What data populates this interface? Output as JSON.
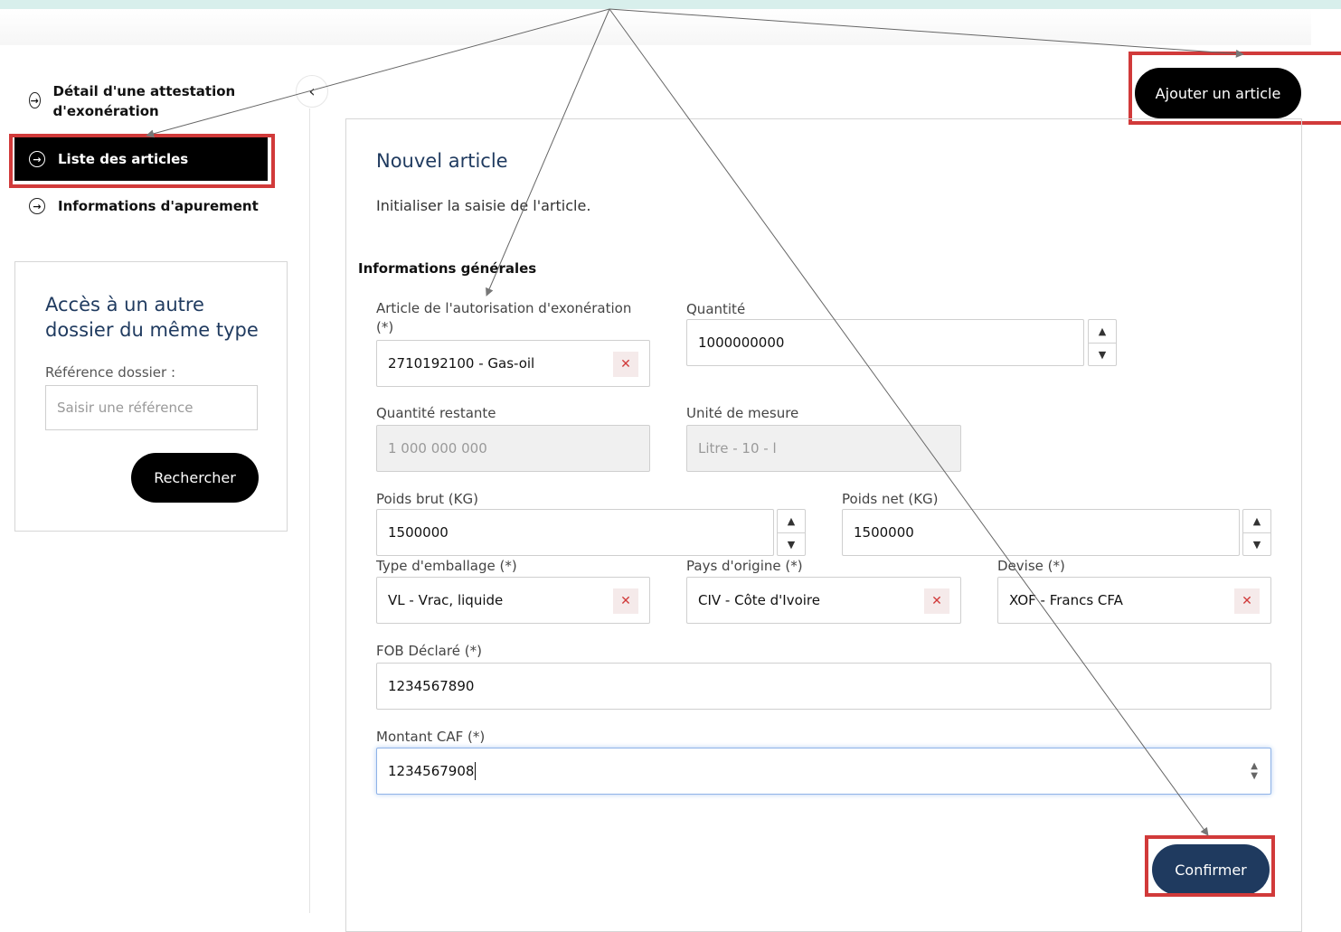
{
  "sidebar": {
    "items": [
      {
        "label": "Détail d'une attestation d'exonération",
        "active": false
      },
      {
        "label": "Liste des articles",
        "active": true
      },
      {
        "label": "Informations d'apurement",
        "active": false
      }
    ],
    "search_card": {
      "title": "Accès à un autre dossier du même type",
      "ref_label": "Référence dossier :",
      "ref_placeholder": "Saisir une référence",
      "search_button": "Rechercher"
    }
  },
  "header": {
    "add_button": "Ajouter un article"
  },
  "form": {
    "title": "Nouvel article",
    "subtitle": "Initialiser la saisie de l'article.",
    "section": "Informations générales",
    "article_label": "Article de l'autorisation d'exonération (*)",
    "article_value": "2710192100 - Gas-oil",
    "quantite_label": "Quantité",
    "quantite_value": "1000000000",
    "quantite_restante_label": "Quantité restante",
    "quantite_restante_value": "1 000 000 000",
    "unite_label": "Unité de mesure",
    "unite_value": "Litre - 10 - l",
    "poids_brut_label": "Poids brut (KG)",
    "poids_brut_value": "1500000",
    "poids_net_label": "Poids net (KG)",
    "poids_net_value": "1500000",
    "emballage_label": "Type d'emballage (*)",
    "emballage_value": "VL - Vrac, liquide",
    "pays_label": "Pays d'origine (*)",
    "pays_value": "CIV - Côte d'Ivoire",
    "devise_label": "Devise (*)",
    "devise_value": "XOF - Francs CFA",
    "fob_label": "FOB Déclaré (*)",
    "fob_value": "1234567890",
    "caf_label": "Montant CAF (*)",
    "caf_value": "1234567908",
    "confirm_button": "Confirmer"
  },
  "colors": {
    "accent_navy": "#1f3a5f",
    "highlight_red": "#d13a3a",
    "clear_red": "#d13a3a"
  }
}
